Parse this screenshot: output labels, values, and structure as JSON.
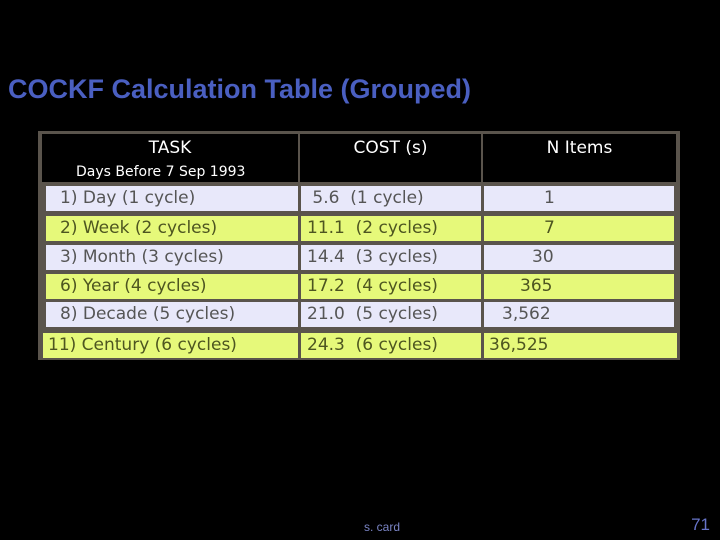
{
  "title": "COCKF Calculation Table (Grouped)",
  "table": {
    "headers": {
      "task": "TASK",
      "task_sub": "Days Before 7 Sep 1993",
      "cost": "COST (s)",
      "n_items": "N Items"
    },
    "rows": [
      {
        "task": "1) Day (1 cycle)",
        "cost": " 5.6  (1 cycle)",
        "n_items": "1",
        "style": "lavender"
      },
      {
        "task": "2) Week (2 cycles)",
        "cost": "11.1  (2 cycles)",
        "n_items": "7",
        "style": "lime"
      },
      {
        "task": "3) Month (3 cycles)",
        "cost": "14.4  (3 cycles)",
        "n_items": "30",
        "style": "lavender"
      },
      {
        "task": "6) Year (4 cycles)",
        "cost": "17.2  (4 cycles)",
        "n_items": "365",
        "style": "lime"
      },
      {
        "task": "8) Decade (5 cycles)",
        "cost": "21.0  (5 cycles)",
        "n_items": "3,562",
        "style": "lavender"
      },
      {
        "task": "11) Century (6 cycles)",
        "cost": "24.3  (6 cycles)",
        "n_items": "36,525",
        "style": "lime"
      }
    ]
  },
  "footer": {
    "author": "s. card",
    "page_number": "71"
  },
  "colors": {
    "title": "#4a5fc1",
    "row_lavender": "#e8e8fa",
    "row_lime": "#e6f97a",
    "table_border": "#5a544c"
  }
}
